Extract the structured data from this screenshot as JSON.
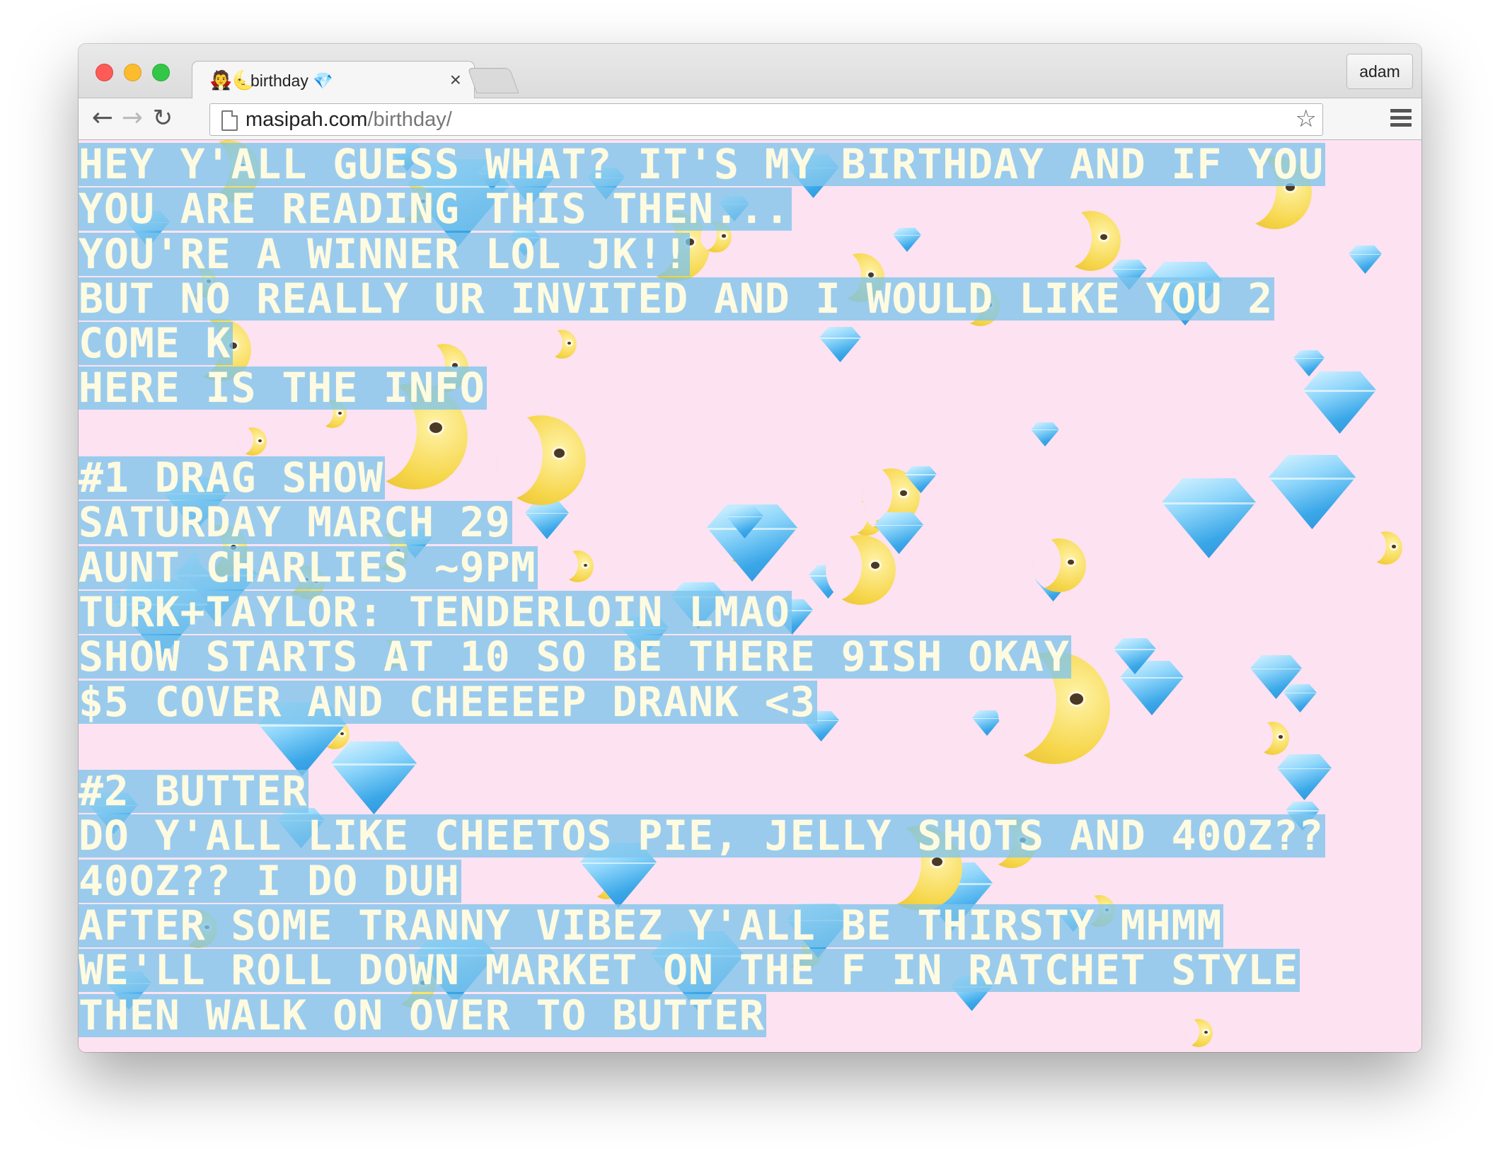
{
  "browser": {
    "tab": {
      "favicon": "🧛🌜",
      "title": "birthday 💎"
    },
    "profile_name": "adam",
    "url": {
      "host": "masipah.com",
      "path": "/birthday/"
    },
    "icons": {
      "back": "←",
      "forward": "→",
      "reload": "↻",
      "star": "☆",
      "close": "×"
    }
  },
  "page": {
    "background_color": "#fde2f2",
    "highlight_color": "#7ec4ec",
    "lines": [
      "HEY Y'ALL GUESS WHAT? IT'S MY BIRTHDAY AND IF YOU",
      "YOU ARE READING THIS THEN...",
      "YOU'RE A WINNER LOL JK!!",
      "BUT NO REALLY UR INVITED AND I WOULD LIKE YOU 2",
      "COME K",
      "HERE IS THE INFO",
      "",
      "#1 DRAG SHOW",
      "SATURDAY MARCH 29",
      "AUNT CHARLIES ~9PM",
      "TURK+TAYLOR: TENDERLOIN LMAO",
      "SHOW STARTS AT 10 SO BE THERE 9ISH OKAY",
      "$5 COVER AND CHEEEEP DRANK <3",
      "",
      "#2 BUTTER",
      "DO Y'ALL LIKE CHEETOS PIE, JELLY SHOTS AND 40OZ??",
      "40OZ?? I DO DUH",
      "AFTER SOME TRANNY VIBEZ Y'ALL BE THIRSTY MHMM",
      "WE'LL ROLL DOWN MARKET ON THE F IN RATCHET STYLE",
      "THEN WALK ON OVER TO BUTTER"
    ]
  }
}
